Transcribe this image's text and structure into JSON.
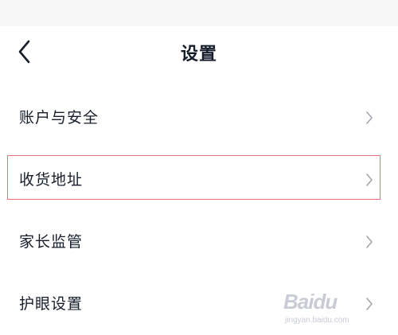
{
  "header": {
    "title": "设置",
    "back_icon": "chevron-left-icon"
  },
  "menu": {
    "items": [
      {
        "label": "账户与安全",
        "icon": "chevron-right-icon"
      },
      {
        "label": "收货地址",
        "icon": "chevron-right-icon",
        "highlighted": true
      },
      {
        "label": "家长监管",
        "icon": "chevron-right-icon"
      },
      {
        "label": "护眼设置",
        "icon": "chevron-right-icon"
      }
    ]
  },
  "watermark": {
    "logo": "Baidu",
    "url": "jingyan.baidu.com"
  },
  "colors": {
    "text": "#161d2b",
    "chevron": "#a3a6ad",
    "highlight_border": "#f06d7a",
    "status_bar": "#f7f7f7"
  }
}
